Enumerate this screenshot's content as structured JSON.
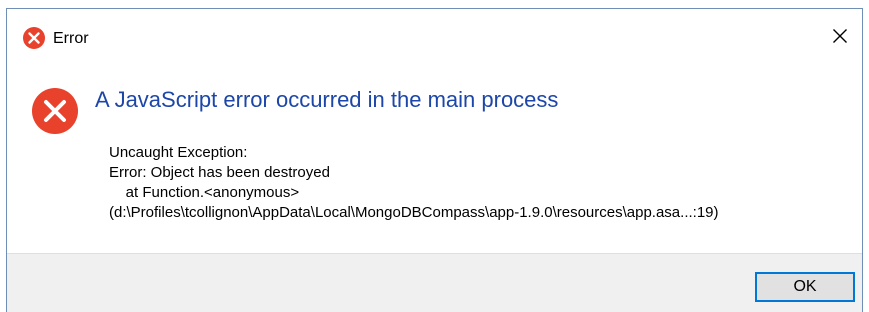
{
  "window": {
    "title": "Error",
    "title_icon": "error-icon",
    "close_glyph": "✕"
  },
  "message": {
    "icon": "error-icon",
    "main_instruction": "A JavaScript error occurred in the main process",
    "lines": [
      "Uncaught Exception:",
      "Error: Object has been destroyed",
      "    at Function.<anonymous>",
      "(d:\\Profiles\\tcollignon\\AppData\\Local\\MongoDBCompass\\app-1.9.0\\resources\\app.asa...:19)"
    ]
  },
  "buttons": {
    "ok_label": "OK"
  },
  "colors": {
    "error_red": "#e8412c",
    "instruction_blue": "#1c46a8",
    "accent_border": "#0078d7",
    "footer_bg": "#f0f0f0"
  }
}
